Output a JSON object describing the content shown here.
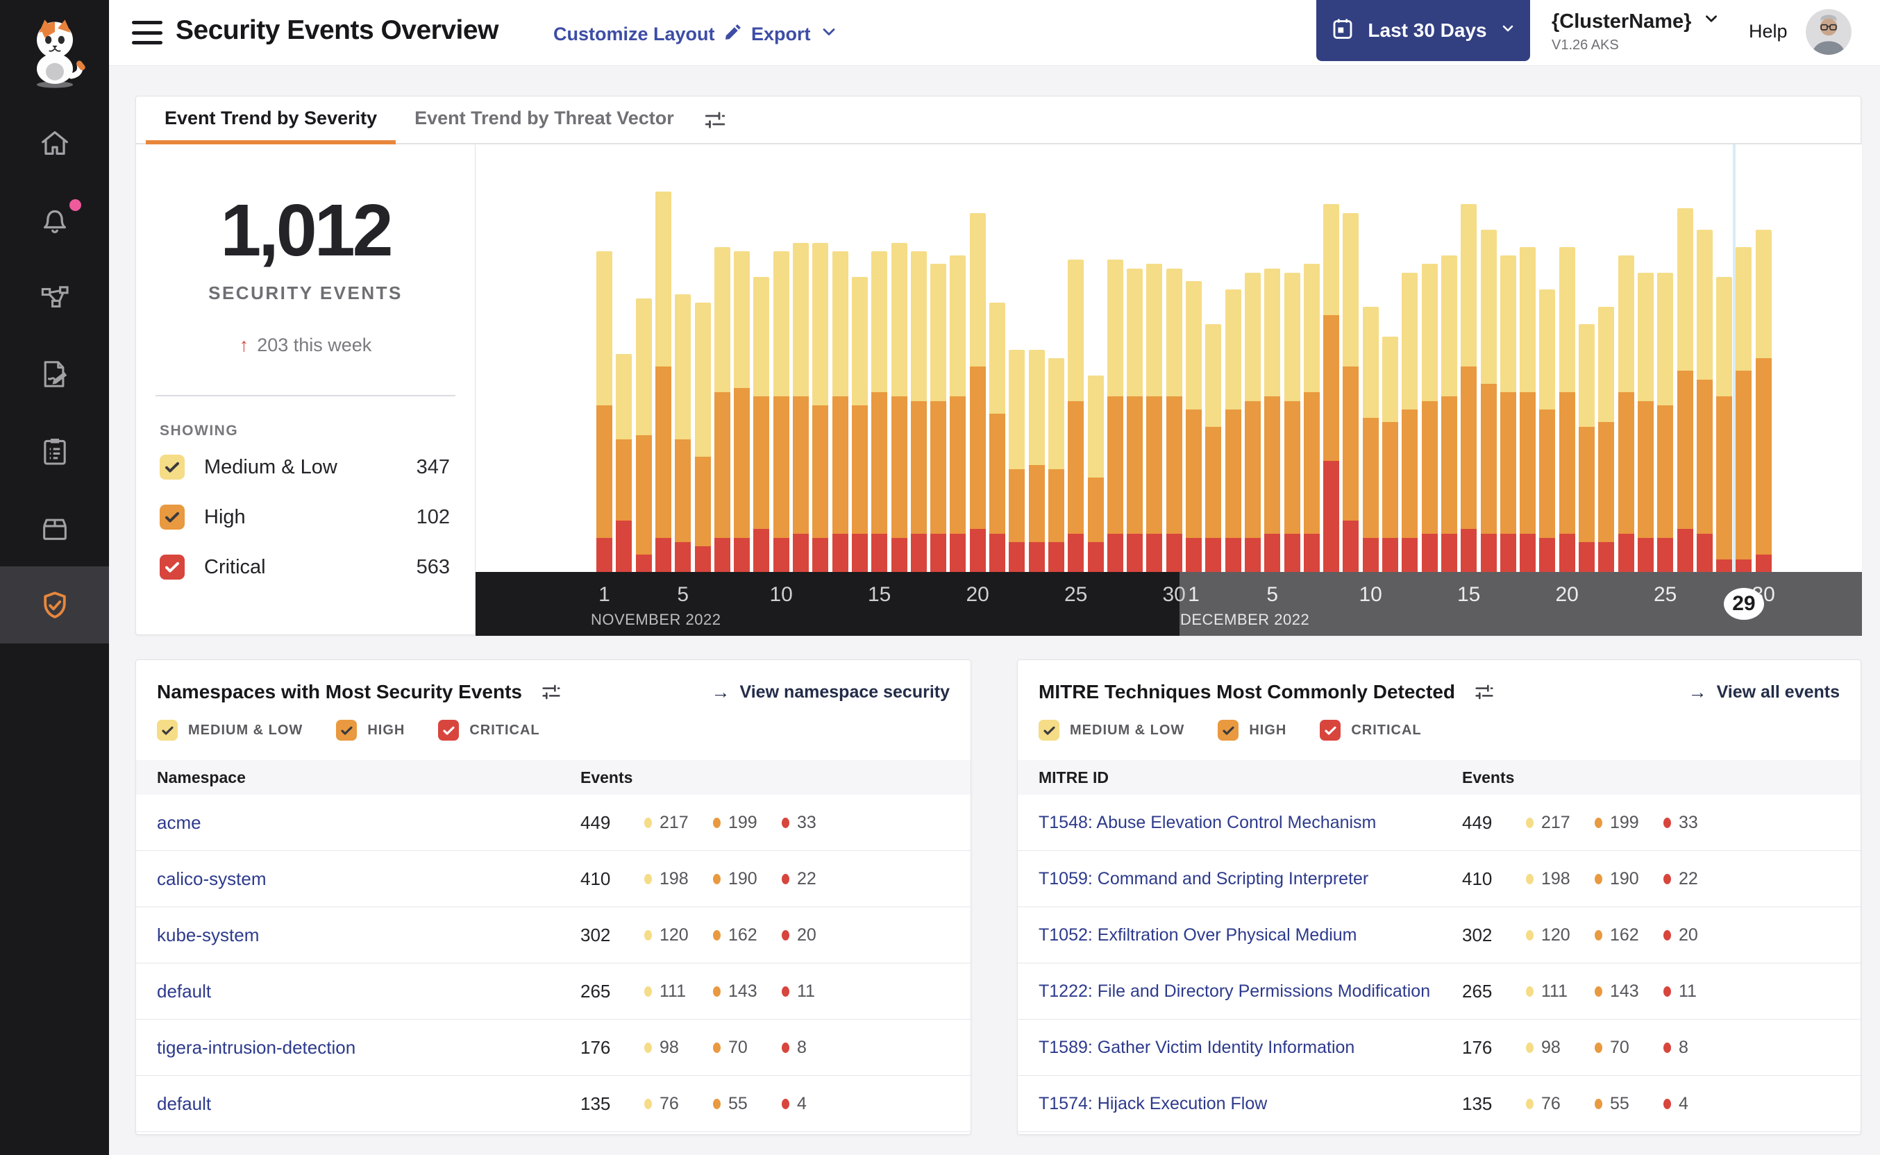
{
  "app": {
    "page_bg": "#F4F4F6",
    "accent_orange": "#E8873C",
    "card_bg": "#FFFFFF"
  },
  "severity": [
    {
      "key": "medium_low",
      "chip_label": "MEDIUM & LOW",
      "color": "#F5DC86",
      "check_color": "#3A3A3E"
    },
    {
      "key": "high",
      "chip_label": "HIGH",
      "color": "#E9993F",
      "check_color": "#3A3A3E"
    },
    {
      "key": "critical",
      "chip_label": "CRITICAL",
      "color": "#D8453D",
      "check_color": "#FFFFFF"
    }
  ],
  "sidebar": {
    "logo": "calico-cat-logo",
    "items": [
      {
        "id": "home",
        "icon": "home",
        "active": false,
        "badge": false
      },
      {
        "id": "alerts",
        "icon": "bell",
        "active": false,
        "badge": true
      },
      {
        "id": "service-graph",
        "icon": "network",
        "active": false,
        "badge": false
      },
      {
        "id": "policies",
        "icon": "document-pencil",
        "active": false,
        "badge": false
      },
      {
        "id": "compliance",
        "icon": "clipboard",
        "active": false,
        "badge": false
      },
      {
        "id": "manage",
        "icon": "box",
        "active": false,
        "badge": false
      },
      {
        "id": "threat-defense",
        "icon": "shield-check",
        "active": true,
        "badge": false
      }
    ]
  },
  "header": {
    "title": "Security Events Overview",
    "customize_layout": "Customize Layout",
    "export": "Export",
    "date_range": "Last 30 Days",
    "cluster_name": "{ClusterName}",
    "cluster_version": "V1.26 AKS",
    "help": "Help"
  },
  "tabs": {
    "items": [
      {
        "label": "Event Trend by Severity",
        "active": true
      },
      {
        "label": "Event Trend by Threat Vector",
        "active": false
      }
    ]
  },
  "summary": {
    "total": "1,012",
    "label": "SECURITY EVENTS",
    "delta_arrow": "↑",
    "delta": "203 this week",
    "showing_label": "SHOWING",
    "filters": [
      {
        "label": "Medium & Low",
        "count": "347",
        "severity": "medium_low",
        "checked": true
      },
      {
        "label": "High",
        "count": "102",
        "severity": "high",
        "checked": true
      },
      {
        "label": "Critical",
        "count": "563",
        "severity": "critical",
        "checked": true
      }
    ]
  },
  "chart_data": {
    "type": "bar",
    "stacked": true,
    "x_months": [
      {
        "label": "NOVEMBER 2022",
        "days": 30
      },
      {
        "label": "DECEMBER 2022",
        "days": 30
      }
    ],
    "tick_days": [
      1,
      5,
      10,
      15,
      20,
      25,
      30
    ],
    "ylim": [
      0,
      100
    ],
    "grid": false,
    "legend": "none",
    "marker": {
      "month": 1,
      "day": 29,
      "label": "29"
    },
    "series": [
      {
        "name": "Medium & Low",
        "color": "#F5DC86",
        "values": [
          36,
          20,
          32,
          41,
          34,
          36,
          34,
          32,
          28,
          34,
          36,
          38,
          34,
          30,
          33,
          36,
          35,
          32,
          33,
          36,
          26,
          28,
          27,
          26,
          33,
          24,
          32,
          30,
          31,
          30,
          30,
          24,
          28,
          30,
          30,
          30,
          30,
          26,
          36,
          26,
          20,
          32,
          32,
          33,
          38,
          36,
          32,
          34,
          28,
          34,
          24,
          27,
          32,
          30,
          31,
          38,
          35,
          28,
          29,
          30
        ]
      },
      {
        "name": "High",
        "color": "#E9993F",
        "values": [
          31,
          19,
          28,
          40,
          24,
          21,
          34,
          35,
          31,
          33,
          32,
          31,
          32,
          30,
          33,
          33,
          31,
          31,
          32,
          38,
          28,
          17,
          18,
          17,
          31,
          15,
          32,
          32,
          32,
          32,
          30,
          26,
          30,
          32,
          32,
          31,
          33,
          34,
          36,
          28,
          27,
          30,
          31,
          32,
          38,
          35,
          33,
          33,
          30,
          33,
          27,
          28,
          33,
          32,
          31,
          37,
          36,
          38,
          44,
          46
        ]
      },
      {
        "name": "Critical",
        "color": "#D8453D",
        "values": [
          8,
          12,
          4,
          8,
          7,
          6,
          8,
          8,
          10,
          8,
          9,
          8,
          9,
          9,
          9,
          8,
          9,
          9,
          9,
          10,
          9,
          7,
          7,
          7,
          9,
          7,
          9,
          9,
          9,
          9,
          8,
          8,
          8,
          8,
          9,
          9,
          9,
          26,
          12,
          8,
          8,
          8,
          9,
          9,
          10,
          9,
          9,
          9,
          8,
          9,
          7,
          7,
          9,
          8,
          8,
          10,
          9,
          3,
          3,
          4
        ]
      }
    ]
  },
  "panels": [
    {
      "id": "namespaces",
      "title": "Namespaces with Most Security Events",
      "link": "View namespace security",
      "link_arrow": "→",
      "columns": [
        "Namespace",
        "Events"
      ],
      "rows": [
        {
          "name": "acme",
          "total": "449",
          "counts": [
            "217",
            "199",
            "33"
          ]
        },
        {
          "name": "calico-system",
          "total": "410",
          "counts": [
            "198",
            "190",
            "22"
          ]
        },
        {
          "name": "kube-system",
          "total": "302",
          "counts": [
            "120",
            "162",
            "20"
          ]
        },
        {
          "name": "default",
          "total": "265",
          "counts": [
            "111",
            "143",
            "11"
          ]
        },
        {
          "name": "tigera-intrusion-detection",
          "total": "176",
          "counts": [
            "98",
            "70",
            "8"
          ]
        },
        {
          "name": "default",
          "total": "135",
          "counts": [
            "76",
            "55",
            "4"
          ]
        }
      ]
    },
    {
      "id": "mitre",
      "title": "MITRE Techniques Most Commonly Detected",
      "link": "View all events",
      "link_arrow": "→",
      "columns": [
        "MITRE ID",
        "Events"
      ],
      "rows": [
        {
          "name": "T1548: Abuse Elevation Control Mechanism",
          "total": "449",
          "counts": [
            "217",
            "199",
            "33"
          ]
        },
        {
          "name": "T1059: Command and Scripting Interpreter",
          "total": "410",
          "counts": [
            "198",
            "190",
            "22"
          ]
        },
        {
          "name": "T1052: Exfiltration Over Physical Medium",
          "total": "302",
          "counts": [
            "120",
            "162",
            "20"
          ]
        },
        {
          "name": "T1222: File and Directory Permissions Modification",
          "total": "265",
          "counts": [
            "111",
            "143",
            "11"
          ]
        },
        {
          "name": "T1589: Gather Victim Identity Information",
          "total": "176",
          "counts": [
            "98",
            "70",
            "8"
          ]
        },
        {
          "name": "T1574: Hijack Execution Flow",
          "total": "135",
          "counts": [
            "76",
            "55",
            "4"
          ]
        }
      ]
    }
  ]
}
